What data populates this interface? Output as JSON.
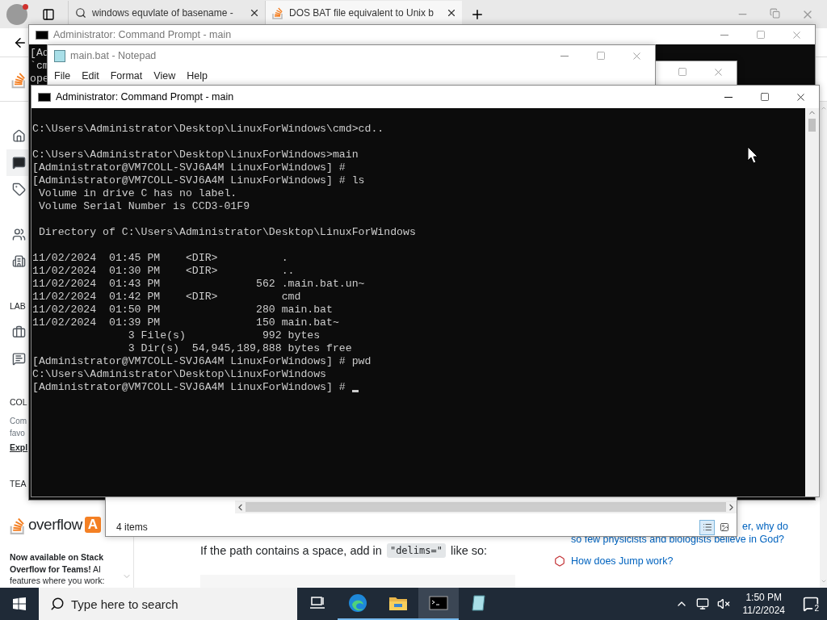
{
  "browser": {
    "tabs": [
      {
        "title": "windows equvlate of basename -",
        "kind": "search",
        "selected": false
      },
      {
        "title": "DOS BAT file equivalent to Unix b",
        "kind": "site",
        "selected": true
      }
    ],
    "sidebar": {
      "nav": [
        {
          "selected": false
        },
        {
          "selected": true
        },
        {
          "selected": false
        },
        {
          "selected": false
        },
        {
          "selected": false
        }
      ],
      "labs_heading": "LAB",
      "labs_items": [
        {
          "selected": false
        },
        {
          "selected": false
        }
      ],
      "collectives_heading": "COL",
      "collectives_text": [
        "Com",
        "favo"
      ],
      "collectives_link": "Expl",
      "teams_heading": "TEA",
      "teams_brand": "overflow",
      "teams_badge": "A",
      "teams_promo": "**Now available on Stack Overflow for Teams!** AI features where you work:"
    },
    "article": {
      "text_before": "If the path contains a space, add in",
      "code": "\"delims=\"",
      "text_after": "like so:"
    },
    "related": [
      {
        "lines": [
          "er, why do",
          "so few physicists and biologists believe in God?"
        ],
        "has_icon": false
      },
      {
        "lines": [
          "How does Jump work?"
        ],
        "has_icon": true
      }
    ]
  },
  "back_console": {
    "title": "Administrator: Command Prompt - main",
    "lines": [
      "[Ad",
      "`cm",
      "ope"
    ]
  },
  "explorer": {
    "status": "4 items",
    "views": [
      {
        "selected": true
      },
      {
        "selected": false
      }
    ]
  },
  "notepad": {
    "title": "main.bat - Notepad",
    "menu": [
      "File",
      "Edit",
      "Format",
      "View",
      "Help"
    ]
  },
  "console": {
    "title": "Administrator: Command Prompt - main",
    "cursor_visible": true,
    "blocks": [
      [
        "C:\\Users\\Administrator\\Desktop\\LinuxForWindows\\cmd>cd.."
      ],
      [
        "C:\\Users\\Administrator\\Desktop\\LinuxForWindows>main",
        "[Administrator@VM7COLL-SVJ6A4M LinuxForWindows] #",
        "[Administrator@VM7COLL-SVJ6A4M LinuxForWindows] # ls",
        " Volume in drive C has no label.",
        " Volume Serial Number is CCD3-01F9"
      ],
      [
        " Directory of C:\\Users\\Administrator\\Desktop\\LinuxForWindows"
      ],
      [
        "11/02/2024  01:45 PM    <DIR>          .",
        "11/02/2024  01:30 PM    <DIR>          ..",
        "11/02/2024  01:43 PM               562 .main.bat.un~",
        "11/02/2024  01:42 PM    <DIR>          cmd",
        "11/02/2024  01:50 PM               280 main.bat",
        "11/02/2024  01:39 PM               150 main.bat~",
        "               3 File(s)            992 bytes",
        "               3 Dir(s)  54,945,189,888 bytes free",
        "[Administrator@VM7COLL-SVJ6A4M LinuxForWindows] # pwd",
        "C:\\Users\\Administrator\\Desktop\\LinuxForWindows",
        "[Administrator@VM7COLL-SVJ6A4M LinuxForWindows] #"
      ]
    ]
  },
  "taskbar": {
    "search_placeholder": "Type here to search",
    "apps": [
      {
        "selected": false,
        "running": false
      },
      {
        "selected": false,
        "running": true
      },
      {
        "selected": false,
        "running": true
      },
      {
        "selected": true,
        "running": true
      },
      {
        "selected": false,
        "running": false
      }
    ],
    "time": "1:50 PM",
    "date": "11/2/2024",
    "notifications": "2"
  }
}
